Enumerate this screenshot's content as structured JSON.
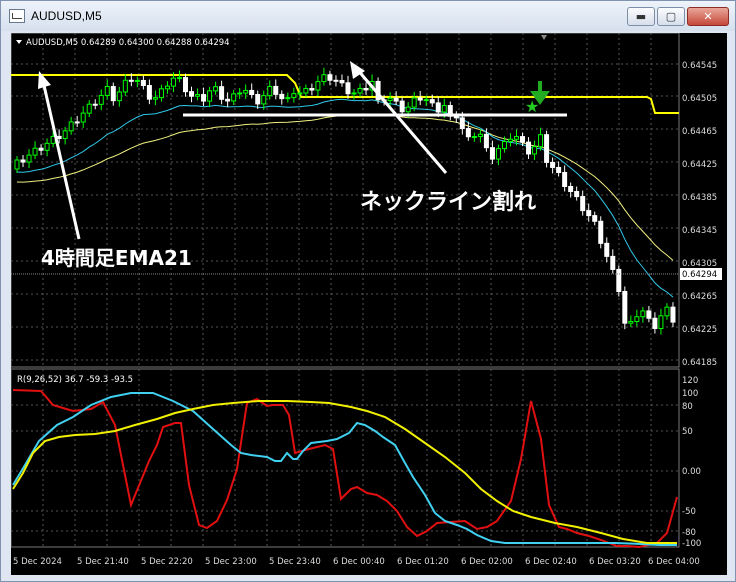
{
  "window": {
    "title": "AUDUSD,M5",
    "buttons": {
      "minimize": "▬",
      "maximize": "▢",
      "close": "✕"
    }
  },
  "chart": {
    "header": "AUDUSD,M5  0.64289 0.64300 0.64288 0.64294",
    "current_price": "0.64294",
    "price_axis": [
      "0.64545",
      "0.64505",
      "0.64465",
      "0.64425",
      "0.64385",
      "0.64345",
      "0.64305",
      "0.64265",
      "0.64225",
      "0.64185"
    ],
    "time_axis": [
      "5 Dec 2024",
      "5 Dec 21:40",
      "5 Dec 22:20",
      "5 Dec 23:00",
      "5 Dec 23:40",
      "6 Dec 00:40",
      "6 Dec 01:20",
      "6 Dec 02:00",
      "6 Dec 02:40",
      "6 Dec 03:20",
      "6 Dec 04:00"
    ],
    "annotations": {
      "neckline": "ネックライン割れ",
      "ema": "4時間足EMA21"
    },
    "colors": {
      "bull": "#00ff00",
      "bear": "#ffffff",
      "ema_fast": "#30c8e8",
      "ema_slow": "#ffff80",
      "level": "#ffff00",
      "arrow": "#22aa22"
    }
  },
  "indicator": {
    "header": "R(9,26,52) 36.7 -59.3 -93.5",
    "axis": [
      "120",
      "100",
      "80",
      "50",
      "0.00",
      "-50",
      "-80",
      "-100"
    ],
    "colors": {
      "red": "#e01010",
      "cyan": "#40d0f0",
      "yellow": "#f0f000"
    }
  }
}
